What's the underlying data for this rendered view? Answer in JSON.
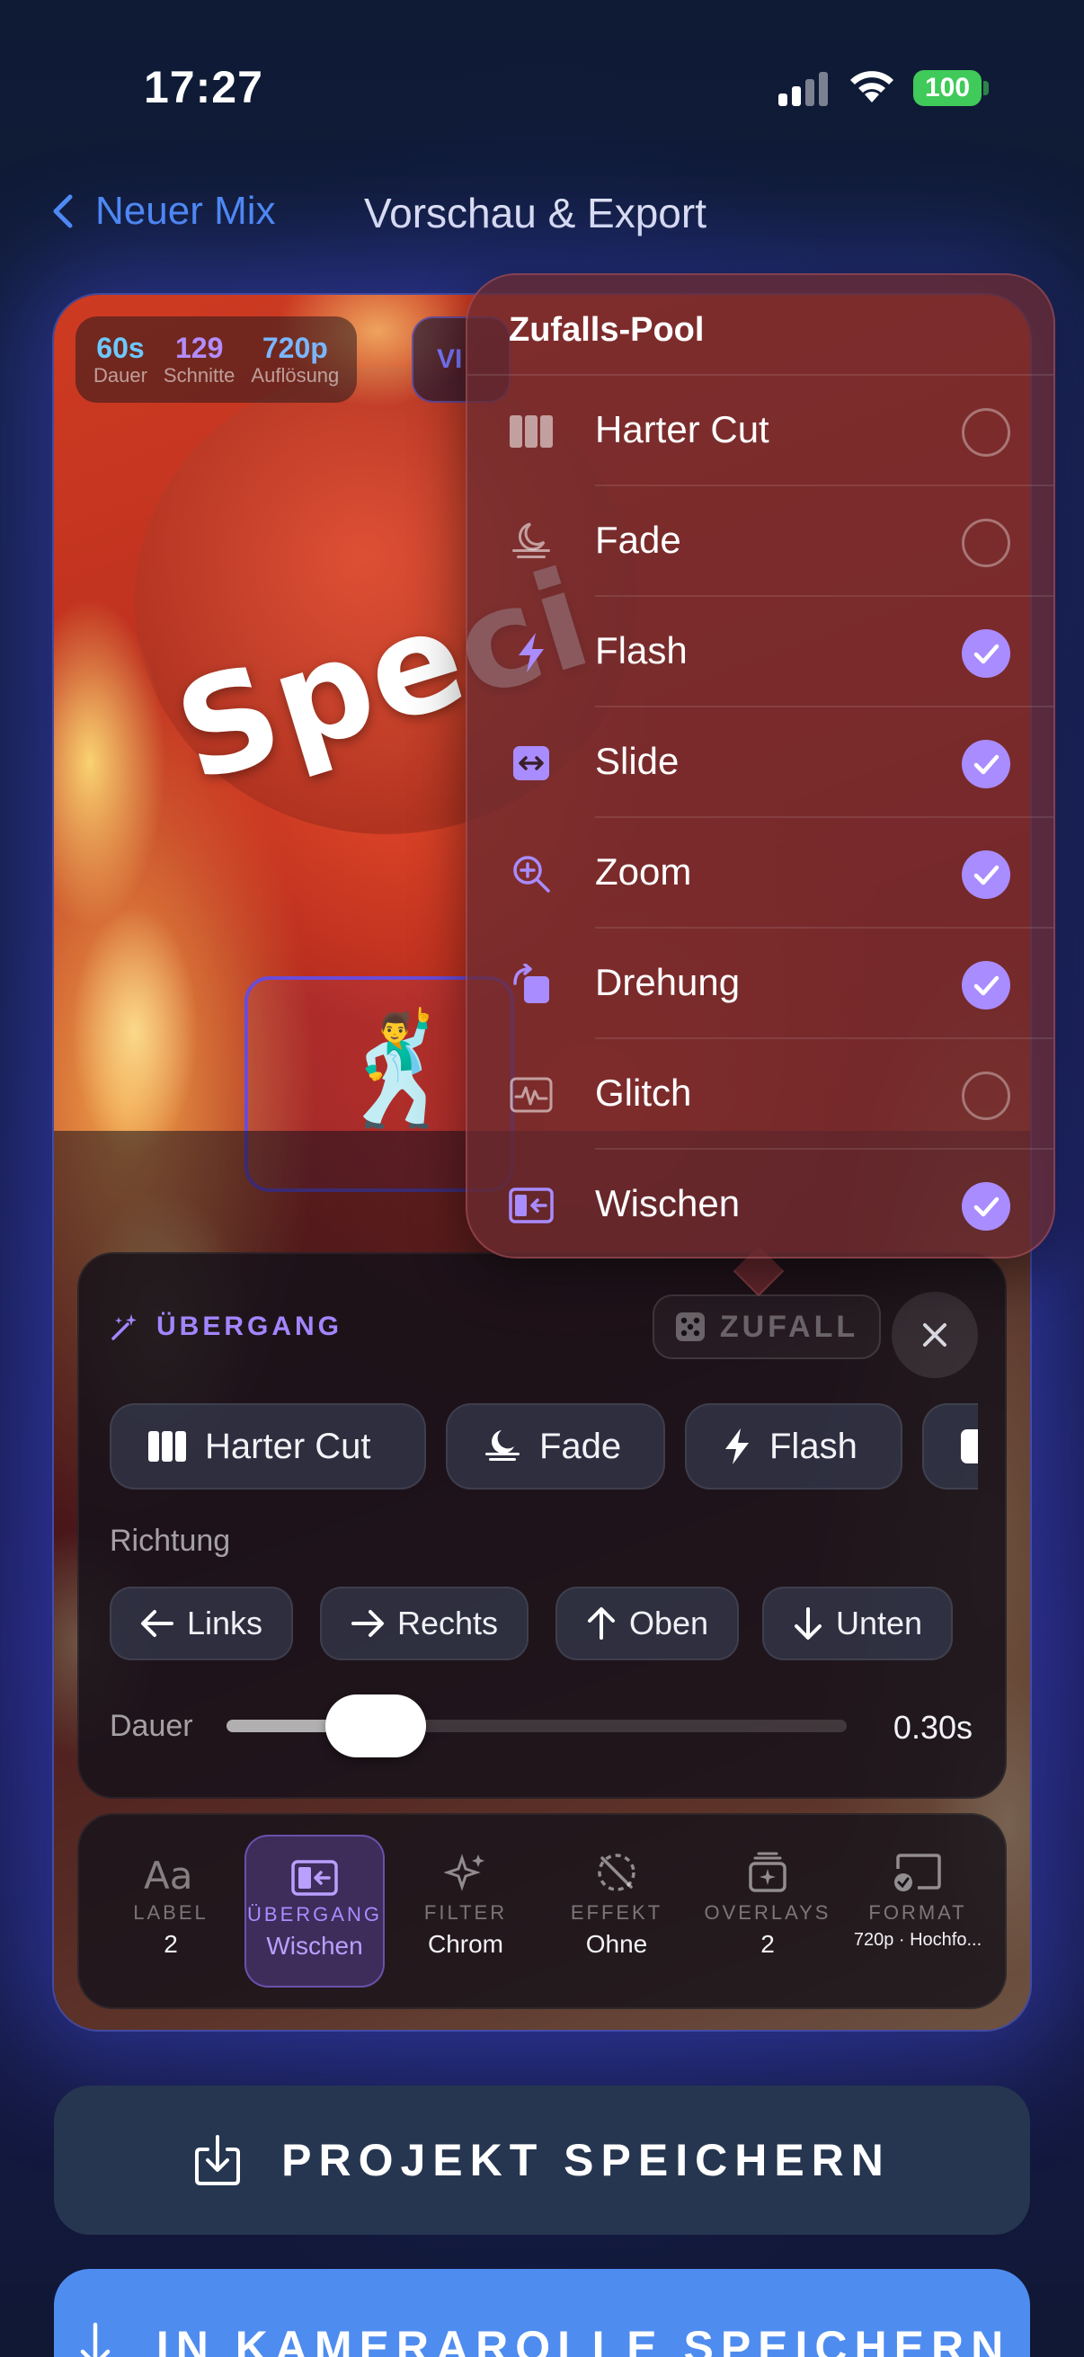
{
  "status": {
    "time": "17:27",
    "battery": "100"
  },
  "nav": {
    "back_label": "Neuer Mix",
    "title": "Vorschau & Export"
  },
  "preview": {
    "overlay_text": "Speci",
    "sticker": "🕺",
    "stats": [
      {
        "value": "60s",
        "label": "Dauer"
      },
      {
        "value": "129",
        "label": "Schnitte"
      },
      {
        "value": "720p",
        "label": "Auflösung"
      }
    ],
    "vi_chip": "VI"
  },
  "popover": {
    "title": "Zufalls-Pool",
    "items": [
      {
        "label": "Harter Cut",
        "icon": "bars-icon",
        "checked": false
      },
      {
        "label": "Fade",
        "icon": "moon-fade-icon",
        "checked": false
      },
      {
        "label": "Flash",
        "icon": "bolt-icon",
        "checked": true
      },
      {
        "label": "Slide",
        "icon": "arrows-horizontal-icon",
        "checked": true
      },
      {
        "label": "Zoom",
        "icon": "zoom-in-icon",
        "checked": true
      },
      {
        "label": "Drehung",
        "icon": "rotate-icon",
        "checked": true
      },
      {
        "label": "Glitch",
        "icon": "waveform-icon",
        "checked": false
      },
      {
        "label": "Wischen",
        "icon": "wipe-icon",
        "checked": true
      }
    ]
  },
  "transition_panel": {
    "header": "ÜBERGANG",
    "random_button": "ZUFALL",
    "chips": [
      "Harter Cut",
      "Fade",
      "Flash"
    ],
    "direction_label": "Richtung",
    "directions": [
      "Links",
      "Rechts",
      "Oben",
      "Unten"
    ],
    "duration_label": "Dauer",
    "duration_value": "0.30s",
    "duration_fraction": 0.24
  },
  "tabs": [
    {
      "label": "LABEL",
      "value": "2",
      "icon": "text-aa-icon"
    },
    {
      "label": "ÜBERGANG",
      "value": "Wischen",
      "icon": "wipe-icon"
    },
    {
      "label": "FILTER",
      "value": "Chrom",
      "icon": "sparkles-icon"
    },
    {
      "label": "EFFEKT",
      "value": "Ohne",
      "icon": "slash-circle-icon"
    },
    {
      "label": "OVERLAYS",
      "value": "2",
      "icon": "layers-icon"
    },
    {
      "label": "FORMAT",
      "value": "720p · Hochfo...",
      "icon": "cast-icon"
    }
  ],
  "buttons": {
    "save_project": "PROJEKT SPEICHERN",
    "save_camera_roll": "IN KAMERAROLLE SPEICHERN"
  },
  "colors": {
    "accent": "#a98cff",
    "link": "#4f8df5",
    "primary_button": "#4f8cf0",
    "battery": "#3fca59"
  }
}
